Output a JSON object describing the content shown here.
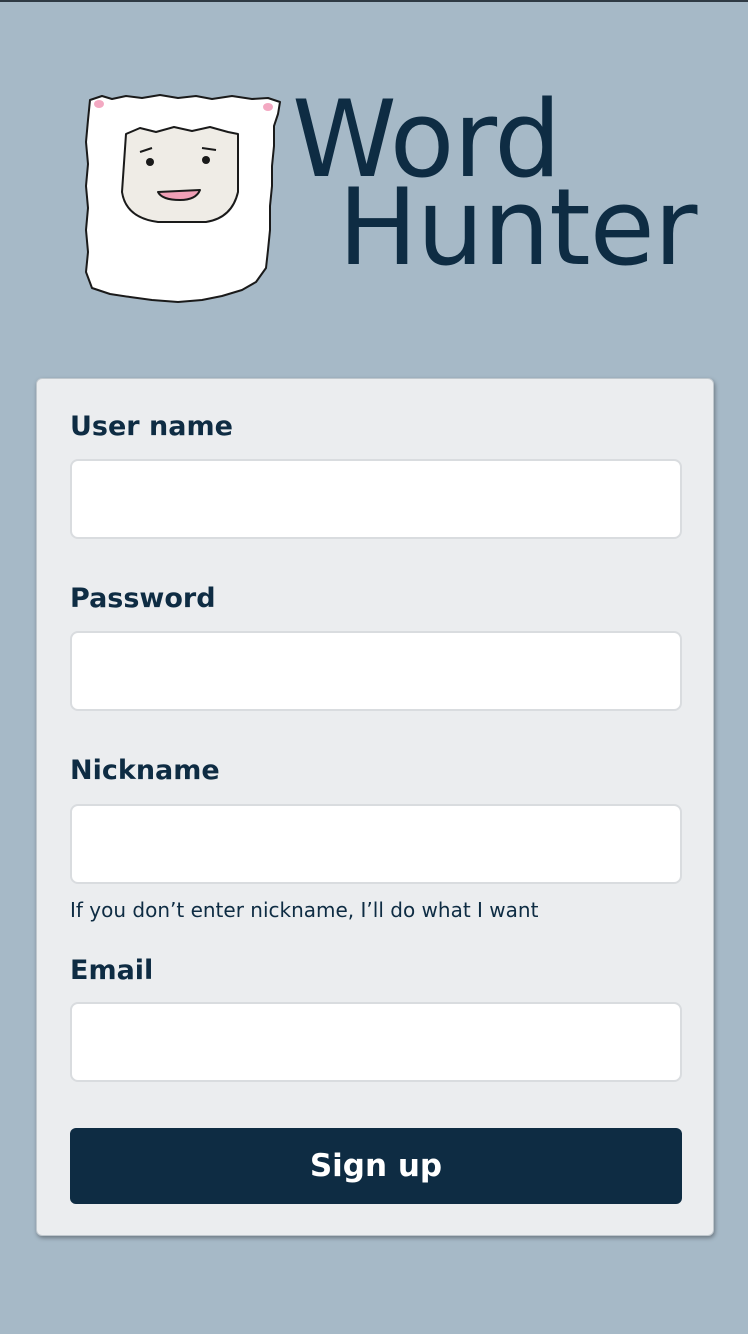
{
  "app": {
    "title_line1": "Word",
    "title_line2": "Hunter"
  },
  "form": {
    "username_label": "User name",
    "username_value": "",
    "password_label": "Password",
    "password_value": "",
    "nickname_label": "Nickname",
    "nickname_value": "",
    "nickname_hint": "If you don’t enter nickname, I’ll do what I want",
    "email_label": "Email",
    "email_value": "",
    "submit_label": "Sign up"
  },
  "colors": {
    "background": "#a6b9c7",
    "card": "#ebedef",
    "primary": "#0e2c43",
    "input_border": "#d9dcdf"
  },
  "icons": {
    "mascot": "sheep-mascot-icon"
  }
}
